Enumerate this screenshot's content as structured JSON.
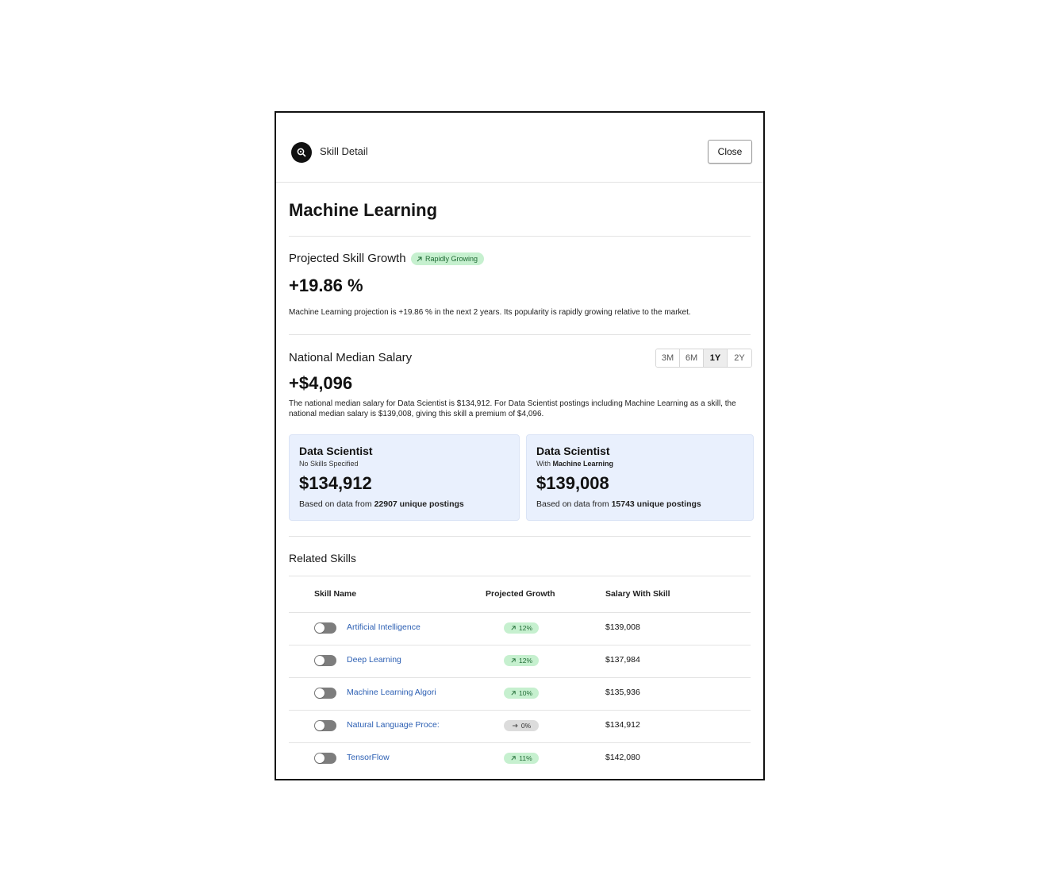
{
  "header": {
    "title": "Skill Detail",
    "close_label": "Close",
    "logo_icon": "search-icon"
  },
  "skill": {
    "name": "Machine Learning"
  },
  "growth": {
    "title": "Projected Skill Growth",
    "badge": "Rapidly Growing",
    "badge_icon": "arrow-up-right-icon",
    "value": "+19.86 %",
    "description": "Machine Learning projection is +19.86 % in the next 2 years. Its popularity is rapidly growing relative to the market."
  },
  "salary": {
    "title": "National Median Salary",
    "ranges": [
      "3M",
      "6M",
      "1Y",
      "2Y"
    ],
    "selected_range": "1Y",
    "value": "+$4,096",
    "description": "The national median salary for Data Scientist is $134,912. For Data Scientist postings including Machine Learning as a skill, the national median salary is $139,008, giving this skill a premium of $4,096.",
    "cards": [
      {
        "role": "Data Scientist",
        "sub_prefix": "No Skills Specified",
        "sub_bold": "",
        "amount": "$134,912",
        "note_prefix": "Based on data from ",
        "note_bold": "22907 unique postings"
      },
      {
        "role": "Data Scientist",
        "sub_prefix": "With ",
        "sub_bold": "Machine Learning",
        "amount": "$139,008",
        "note_prefix": "Based on data from ",
        "note_bold": "15743 unique postings"
      }
    ]
  },
  "related": {
    "title": "Related Skills",
    "columns": {
      "name": "Skill Name",
      "growth": "Projected Growth",
      "salary": "Salary With Skill"
    },
    "rows": [
      {
        "name": "Artificial Intelligence",
        "growth": "12%",
        "trend": "up",
        "salary": "$139,008",
        "enabled": false
      },
      {
        "name": "Deep Learning",
        "growth": "12%",
        "trend": "up",
        "salary": "$137,984",
        "enabled": false
      },
      {
        "name": "Machine Learning Algori",
        "growth": "10%",
        "trend": "up",
        "salary": "$135,936",
        "enabled": false
      },
      {
        "name": "Natural Language Proce:",
        "growth": "0%",
        "trend": "flat",
        "salary": "$134,912",
        "enabled": false
      },
      {
        "name": "TensorFlow",
        "growth": "11%",
        "trend": "up",
        "salary": "$142,080",
        "enabled": false
      }
    ]
  },
  "colors": {
    "accent_green_bg": "#c6f0cf",
    "accent_green_text": "#1f6b34",
    "link_blue": "#2c5fb3",
    "card_bg": "#e9f0fd"
  }
}
